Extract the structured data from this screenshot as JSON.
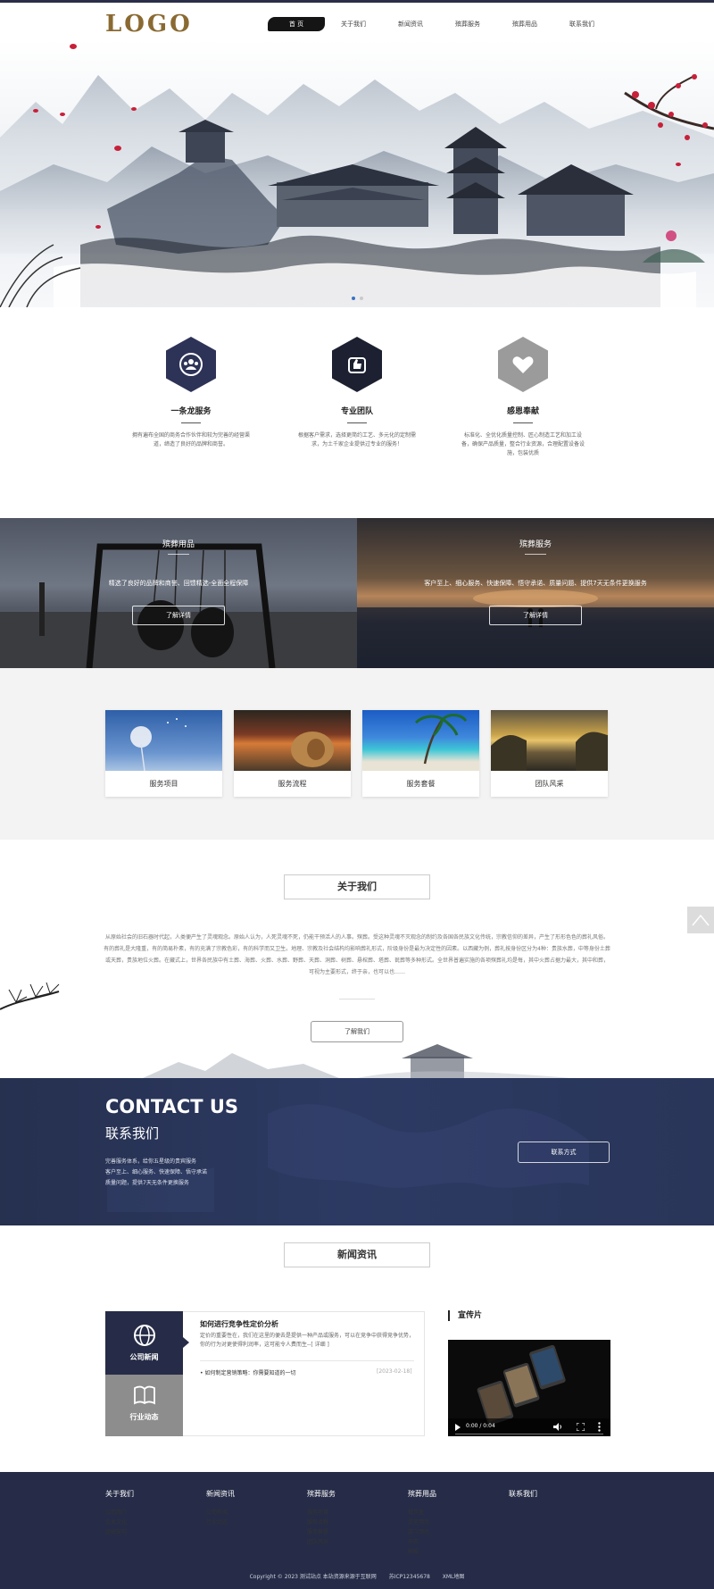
{
  "header": {
    "logo": "LOGO",
    "nav": [
      "首 页",
      "关于我们",
      "新闻资讯",
      "殡葬服务",
      "殡葬用品",
      "联系我们"
    ]
  },
  "features": [
    {
      "title": "一条龙服务",
      "icon": "team-icon",
      "desc": "拥有遍布全国的商务合作伙伴和较为完善的经营渠道，缔造了良好的品牌和商誉。"
    },
    {
      "title": "专业团队",
      "icon": "thumbs-up-icon",
      "desc": "根据客户需求，选择更简约工艺、多元化的定制需求，为土千家企业提供过专业的服务！"
    },
    {
      "title": "感恩奉献",
      "icon": "heart-icon",
      "desc": "标准化、全优化质量控制、匠心制造工艺和加工设备，确保产品质量，整合行业资源，合理配置设备设施，包装优质"
    }
  ],
  "promos": [
    {
      "title": "殡葬用品",
      "desc": "精选了良好的品牌和商誉、回馈精选-全面全程保障",
      "button": "了解详情"
    },
    {
      "title": "殡葬服务",
      "desc": "客户至上、细心服务、快速保障、悟守承诺、质量问题、提供7天无条件更换服务",
      "button": "了解详情"
    }
  ],
  "cards": [
    "服务项目",
    "服务流程",
    "服务套餐",
    "团队风采"
  ],
  "about": {
    "title": "关于我们",
    "text": "从原始社会的旧石器时代起，人类便产生了灵魂观念。原始人认为，人死灵魂不死，仍能干预活人的人事。殡葬。受这种灵魂不灭观念的制约及各国各民族文化传统，宗教信仰的差异，产生了形形色色的葬礼风俗。有的葬礼是大隆重，有的简易朴素，有的充满了宗教色彩，有的科学而又卫生。地理、宗教及社会结构均影响葬礼形式，阶级身份是最为决定性的因素。以西藏为例，葬礼按身份区分为4种：贵族水葬，中等身份土葬或天葬，贵族地位火葬。在藏式上，世界各民族中有土葬、海葬、火葬、水葬、野葬、天葬、洞葬、树葬、悬棺葬、塔葬、瓮葬等多种形式。全世界普遍实施的各项殡葬礼均是每，其中火葬占据力最大，其中和葬，可视为主要形式，终于亲，也可以也……",
    "button": "了解我们"
  },
  "contact": {
    "en": "CONTACT US",
    "cn": "联系我们",
    "lines": [
      "完善服务体系，给你五星级的贵宾服务",
      "客户至上、细心服务、快速保障、悟守承诺",
      "质量问题，提供7天无条件更换服务"
    ],
    "button": "联系方式"
  },
  "news": {
    "title": "新闻资讯",
    "tabs": [
      "公司新闻",
      "行业动态"
    ],
    "headline": "如何进行竞争性定价分析",
    "summary": "定价的重要性在，我们在这里的便去是提供一种产品或服务，可以在竞争中获得竞争优势，你的行为对更使得利润率，这可能令人费而生--[ 详细 ]",
    "item": "如何制定营销策略：你需要知道的一切",
    "date": "[2023-02-18]"
  },
  "sidebar": {
    "title": "宣传片",
    "video_time": "0:00 / 0:04"
  },
  "footer": {
    "columns": [
      {
        "title": "关于我们",
        "links": [
          "公司简介",
          "企业文化",
          "组织架构"
        ]
      },
      {
        "title": "新闻资讯",
        "links": [
          "公司新闻",
          "行业动态"
        ]
      },
      {
        "title": "殡葬服务",
        "links": [
          "服务项目",
          "服务流程",
          "服务套餐",
          "团队风采"
        ]
      },
      {
        "title": "殡葬用品",
        "links": [
          "骨灰盒",
          "灵堂用品",
          "墓穴用品",
          "寿衣",
          "鞋帽"
        ]
      },
      {
        "title": "联系我们",
        "links": []
      }
    ],
    "copyright": "Copyright © 2023 测试站点 本站资源来源于互联网",
    "icp": "苏ICP12345678",
    "sitemap": "XML地图"
  },
  "colors": {
    "navy": "#262c47",
    "gold": "#8a6a32",
    "accent": "#3b72c4"
  }
}
